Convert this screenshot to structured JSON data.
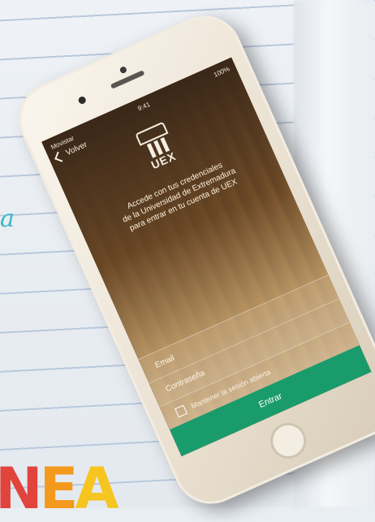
{
  "background": {
    "side_script": "a",
    "brand_letters": [
      "N",
      "E",
      "A"
    ]
  },
  "status_bar": {
    "carrier": "Movistar",
    "time": "9:41",
    "battery": "100%"
  },
  "nav": {
    "back_label": "Volver"
  },
  "logo": {
    "text": "UEX"
  },
  "welcome": {
    "line1": "Accede con tus credenciales",
    "line2": "de la Universidad de Extremadura",
    "line3": "para entrar en tu cuenta de UEX"
  },
  "form": {
    "email_placeholder": "Email",
    "password_placeholder": "Contraseña",
    "remember_label": "Mantener la sesión abierta",
    "submit_label": "Entrar"
  },
  "colors": {
    "primary_button": "#1a9b6c",
    "accent_text": "#e84a3e"
  }
}
